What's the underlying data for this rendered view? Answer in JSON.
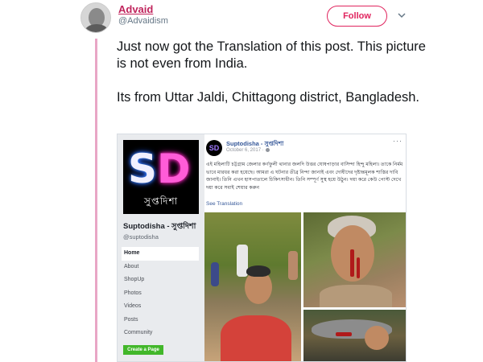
{
  "tweet": {
    "author_name": "Advaid",
    "author_handle": "@Advaidism",
    "follow_label": "Follow",
    "text_paragraphs": [
      "Just now got the Translation of this post. This picture is not even from India.",
      "Its from Uttar Jaldi, Chittagong district, Bangladesh."
    ]
  },
  "fb_page": {
    "logo_letters": "SD",
    "logo_subtitle": "সুপ্তদিশা",
    "page_name": "Suptodisha - সুপ্তদিশা",
    "page_handle": "@suptodisha",
    "nav_items": [
      "Home",
      "About",
      "ShopUp",
      "Photos",
      "Videos",
      "Posts",
      "Community"
    ],
    "active_nav": "Home",
    "create_page_label": "Create a Page"
  },
  "fb_post": {
    "author": "Suptodisha - সুপ্তদিশা",
    "date": "October 6, 2017 ·",
    "more": "···",
    "body": "এই মহিলাটি চট্টগ্রাম জেলার কর্ণফুলী থানার জলদি উত্তর ঘোষপাড়ার বাসিন্দা হিন্দু মহিলা। তাকে নির্মম ভাবে মারধর করা হয়েছে। আমরা এ ঘটনার তীব্র নিন্দা জানাই এবং দোষীদের দৃষ্টান্তমূলক শাস্তির দাবি জানাই। তিনি এখন হাসপাতালে চিকিৎসাধীন। তিনি সম্পূর্ণ সুস্থ হয়ে উঠুন। দয়া করে কেউ পোস্ট দেখে দয়া করে সবাই শেয়ার করুন",
    "see_translation": "See Translation",
    "avatar_letters": "SD"
  },
  "colors": {
    "follow": "#e0245e",
    "thread_line": "#e8a6c6",
    "fb_link": "#365899",
    "create_page": "#42b72a"
  }
}
